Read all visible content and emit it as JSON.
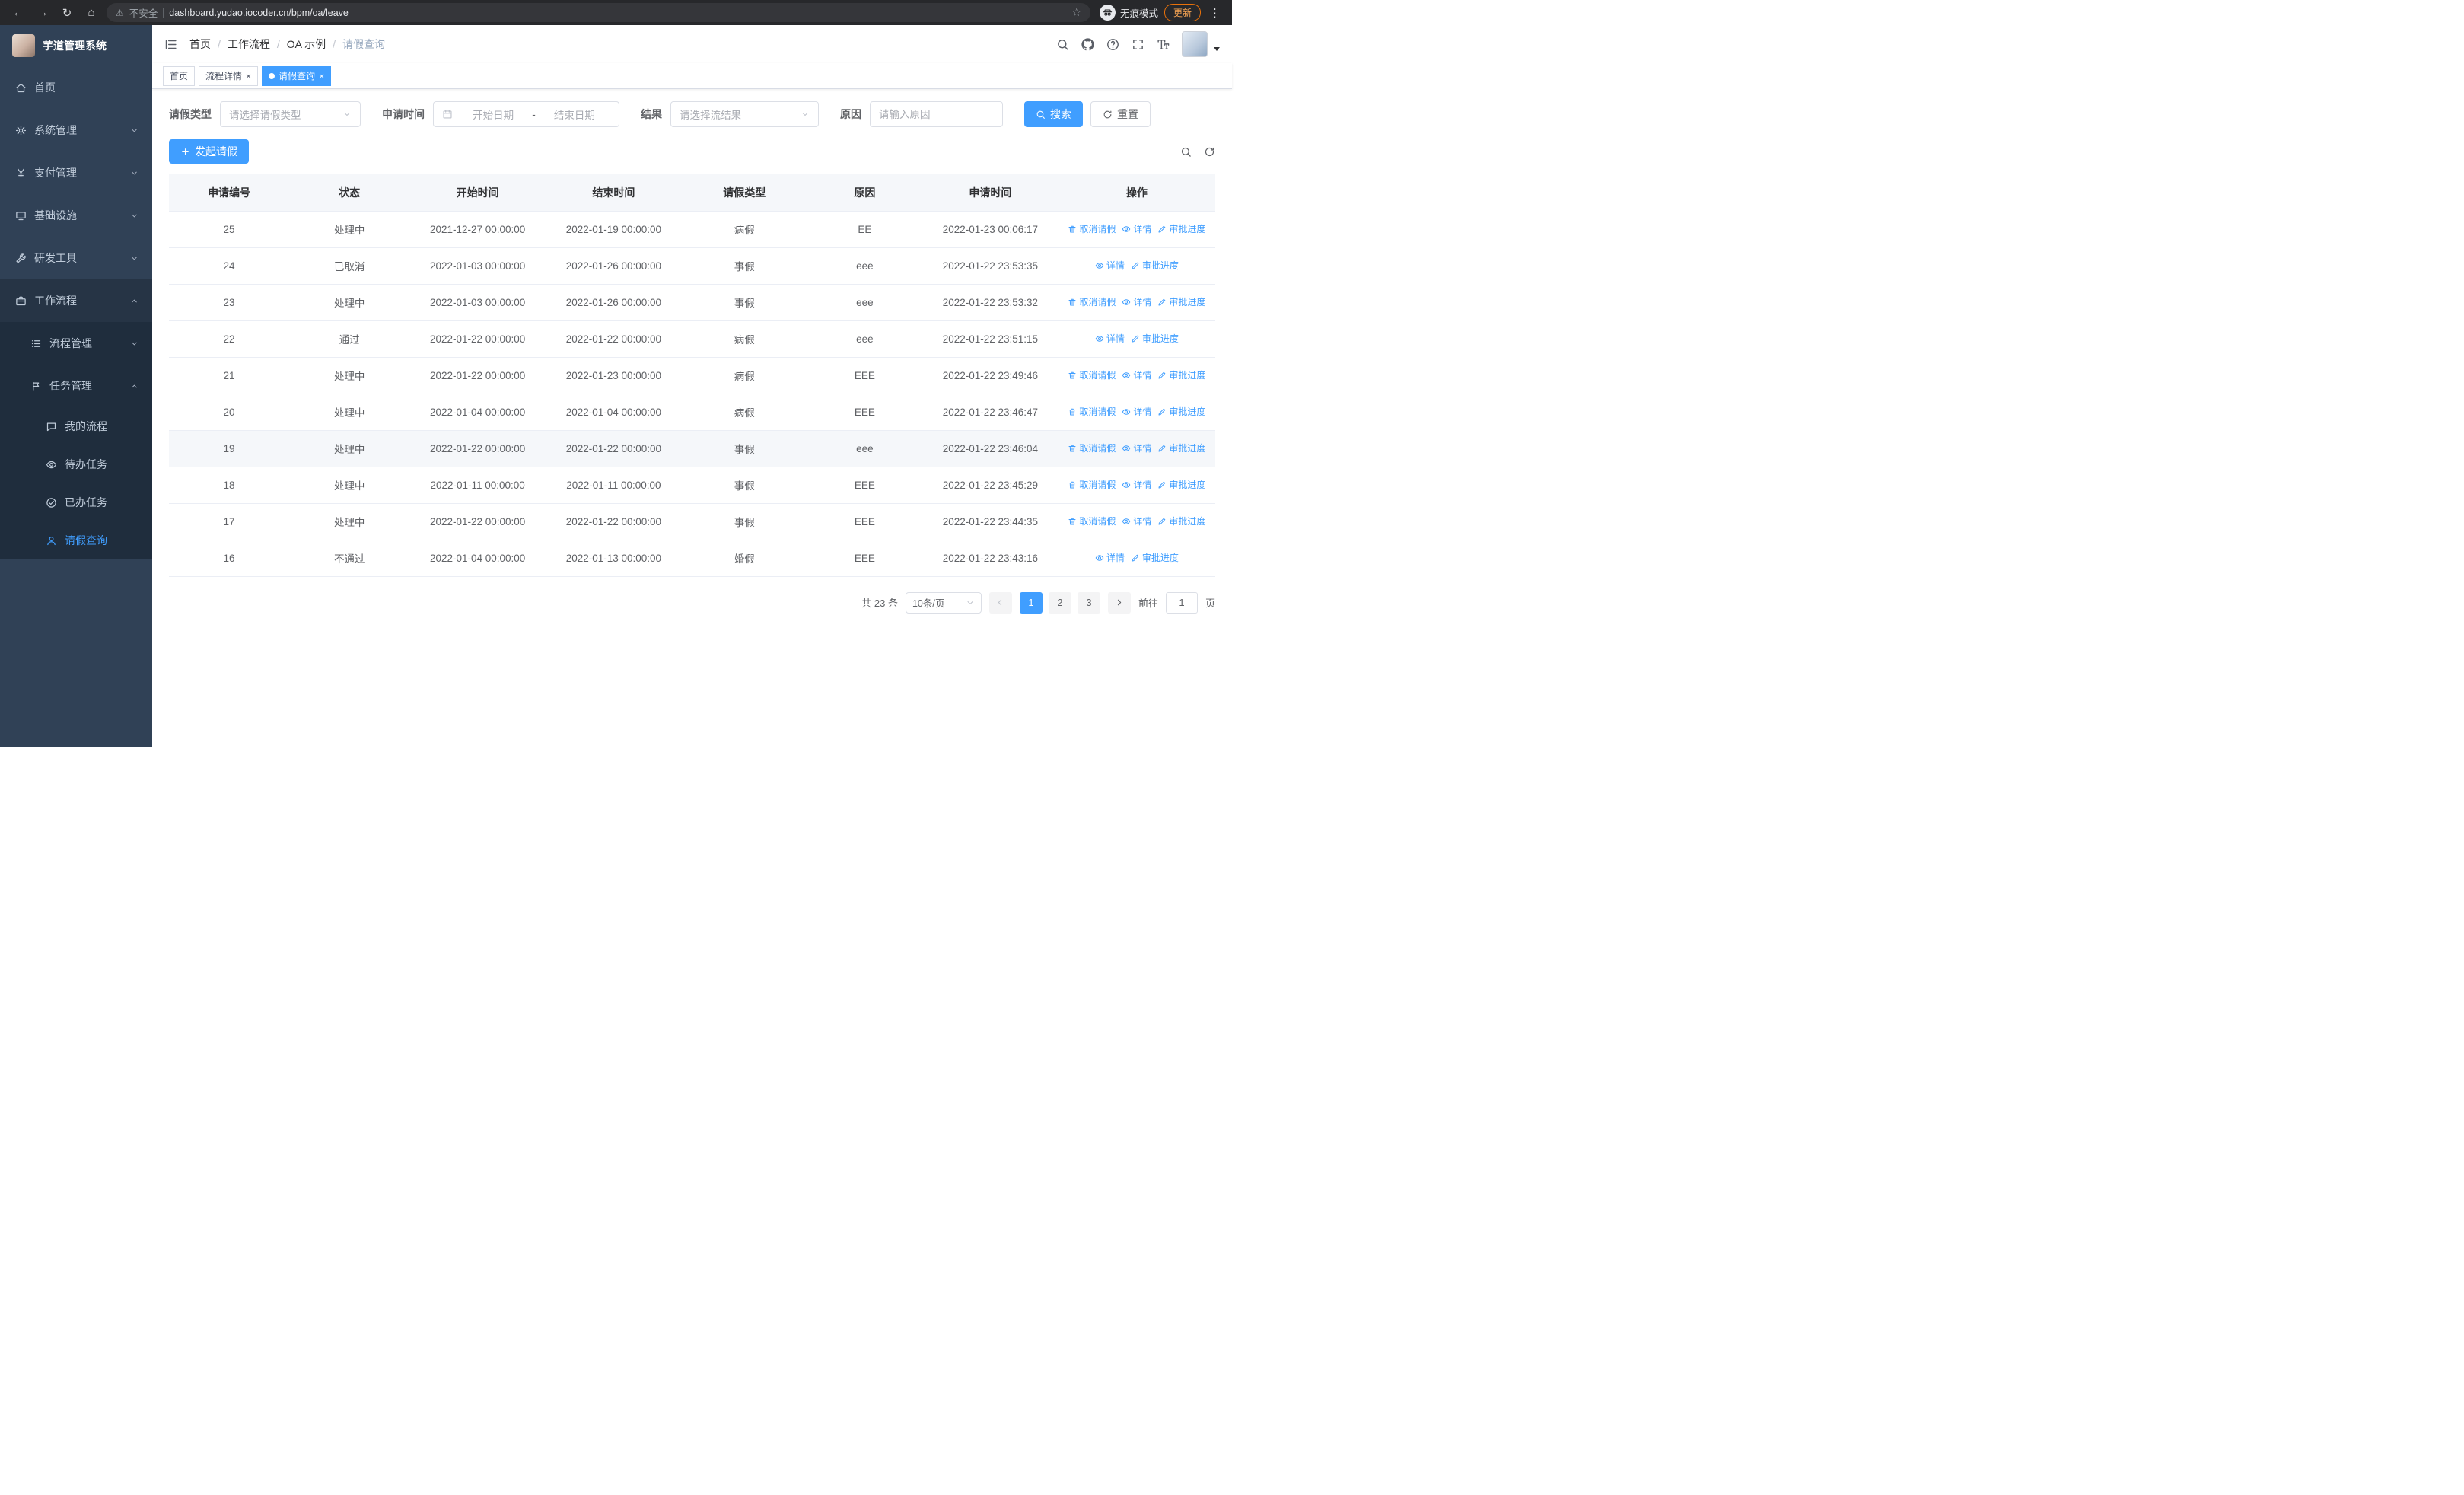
{
  "browser": {
    "security_warning": "不安全",
    "url": "dashboard.yudao.iocoder.cn/bpm/oa/leave",
    "incognito_label": "无痕模式",
    "update_button": "更新"
  },
  "sidebar": {
    "app_title": "芋道管理系统",
    "items": [
      {
        "key": "home",
        "label": "首页",
        "icon": "home-icon",
        "level": 0
      },
      {
        "key": "system",
        "label": "系统管理",
        "icon": "gear-icon",
        "level": 0,
        "arrow": "down"
      },
      {
        "key": "payment",
        "label": "支付管理",
        "icon": "yen-icon",
        "level": 0,
        "arrow": "down"
      },
      {
        "key": "infrastructure",
        "label": "基础设施",
        "icon": "monitor-icon",
        "level": 0,
        "arrow": "down"
      },
      {
        "key": "dev-tools",
        "label": "研发工具",
        "icon": "tools-icon",
        "level": 0,
        "arrow": "down"
      },
      {
        "key": "workflow",
        "label": "工作流程",
        "icon": "briefcase-icon",
        "level": 0,
        "arrow": "up",
        "open": true
      },
      {
        "key": "process-management",
        "label": "流程管理",
        "icon": "list-icon",
        "level": 1,
        "arrow": "down"
      },
      {
        "key": "task-management",
        "label": "任务管理",
        "icon": "flag-icon",
        "level": 1,
        "arrow": "up",
        "open": true
      },
      {
        "key": "my-process",
        "label": "我的流程",
        "icon": "chat-icon",
        "level": 2
      },
      {
        "key": "todo-tasks",
        "label": "待办任务",
        "icon": "eye-icon",
        "level": 2
      },
      {
        "key": "done-tasks",
        "label": "已办任务",
        "icon": "check-circle-icon",
        "level": 2
      },
      {
        "key": "leave-query",
        "label": "请假查询",
        "icon": "user-icon",
        "level": 2,
        "active": true
      }
    ]
  },
  "header": {
    "breadcrumb": [
      "首页",
      "工作流程",
      "OA 示例",
      "请假查询"
    ],
    "breadcrumb_separator": "/"
  },
  "tabs": [
    {
      "key": "home",
      "label": "首页",
      "closable": false,
      "active": false
    },
    {
      "key": "process-detail",
      "label": "流程详情",
      "closable": true,
      "active": false
    },
    {
      "key": "leave-query",
      "label": "请假查询",
      "closable": true,
      "active": true
    }
  ],
  "filters": {
    "leave_type_label": "请假类型",
    "leave_type_placeholder": "请选择请假类型",
    "apply_time_label": "申请时间",
    "start_date_placeholder": "开始日期",
    "date_separator": "-",
    "end_date_placeholder": "结束日期",
    "result_label": "结果",
    "result_placeholder": "请选择流结果",
    "reason_label": "原因",
    "reason_placeholder": "请输入原因",
    "search_button": "搜索",
    "reset_button": "重置"
  },
  "toolbar": {
    "create_button": "发起请假"
  },
  "table": {
    "columns": [
      "申请编号",
      "状态",
      "开始时间",
      "结束时间",
      "请假类型",
      "原因",
      "申请时间",
      "操作"
    ],
    "action_labels": {
      "cancel": "取消请假",
      "detail": "详情",
      "progress": "审批进度"
    },
    "rows": [
      {
        "id": "25",
        "status": "处理中",
        "start": "2021-12-27 00:00:00",
        "end": "2022-01-19 00:00:00",
        "type": "病假",
        "reason": "EE",
        "apply_time": "2022-01-23 00:06:17",
        "actions": [
          "cancel",
          "detail",
          "progress"
        ]
      },
      {
        "id": "24",
        "status": "已取消",
        "start": "2022-01-03 00:00:00",
        "end": "2022-01-26 00:00:00",
        "type": "事假",
        "reason": "eee",
        "apply_time": "2022-01-22 23:53:35",
        "actions": [
          "detail",
          "progress"
        ]
      },
      {
        "id": "23",
        "status": "处理中",
        "start": "2022-01-03 00:00:00",
        "end": "2022-01-26 00:00:00",
        "type": "事假",
        "reason": "eee",
        "apply_time": "2022-01-22 23:53:32",
        "actions": [
          "cancel",
          "detail",
          "progress"
        ]
      },
      {
        "id": "22",
        "status": "通过",
        "start": "2022-01-22 00:00:00",
        "end": "2022-01-22 00:00:00",
        "type": "病假",
        "reason": "eee",
        "apply_time": "2022-01-22 23:51:15",
        "actions": [
          "detail",
          "progress"
        ]
      },
      {
        "id": "21",
        "status": "处理中",
        "start": "2022-01-22 00:00:00",
        "end": "2022-01-23 00:00:00",
        "type": "病假",
        "reason": "EEE",
        "apply_time": "2022-01-22 23:49:46",
        "actions": [
          "cancel",
          "detail",
          "progress"
        ]
      },
      {
        "id": "20",
        "status": "处理中",
        "start": "2022-01-04 00:00:00",
        "end": "2022-01-04 00:00:00",
        "type": "病假",
        "reason": "EEE",
        "apply_time": "2022-01-22 23:46:47",
        "actions": [
          "cancel",
          "detail",
          "progress"
        ]
      },
      {
        "id": "19",
        "status": "处理中",
        "start": "2022-01-22 00:00:00",
        "end": "2022-01-22 00:00:00",
        "type": "事假",
        "reason": "eee",
        "apply_time": "2022-01-22 23:46:04",
        "actions": [
          "cancel",
          "detail",
          "progress"
        ],
        "highlighted": true
      },
      {
        "id": "18",
        "status": "处理中",
        "start": "2022-01-11 00:00:00",
        "end": "2022-01-11 00:00:00",
        "type": "事假",
        "reason": "EEE",
        "apply_time": "2022-01-22 23:45:29",
        "actions": [
          "cancel",
          "detail",
          "progress"
        ]
      },
      {
        "id": "17",
        "status": "处理中",
        "start": "2022-01-22 00:00:00",
        "end": "2022-01-22 00:00:00",
        "type": "事假",
        "reason": "EEE",
        "apply_time": "2022-01-22 23:44:35",
        "actions": [
          "cancel",
          "detail",
          "progress"
        ]
      },
      {
        "id": "16",
        "status": "不通过",
        "start": "2022-01-04 00:00:00",
        "end": "2022-01-13 00:00:00",
        "type": "婚假",
        "reason": "EEE",
        "apply_time": "2022-01-22 23:43:16",
        "actions": [
          "detail",
          "progress"
        ]
      }
    ]
  },
  "pagination": {
    "total_text": "共 23 条",
    "page_size": "10条/页",
    "pages": [
      "1",
      "2",
      "3"
    ],
    "active_page": "1",
    "goto_label": "前往",
    "goto_value": "1",
    "goto_suffix": "页"
  }
}
